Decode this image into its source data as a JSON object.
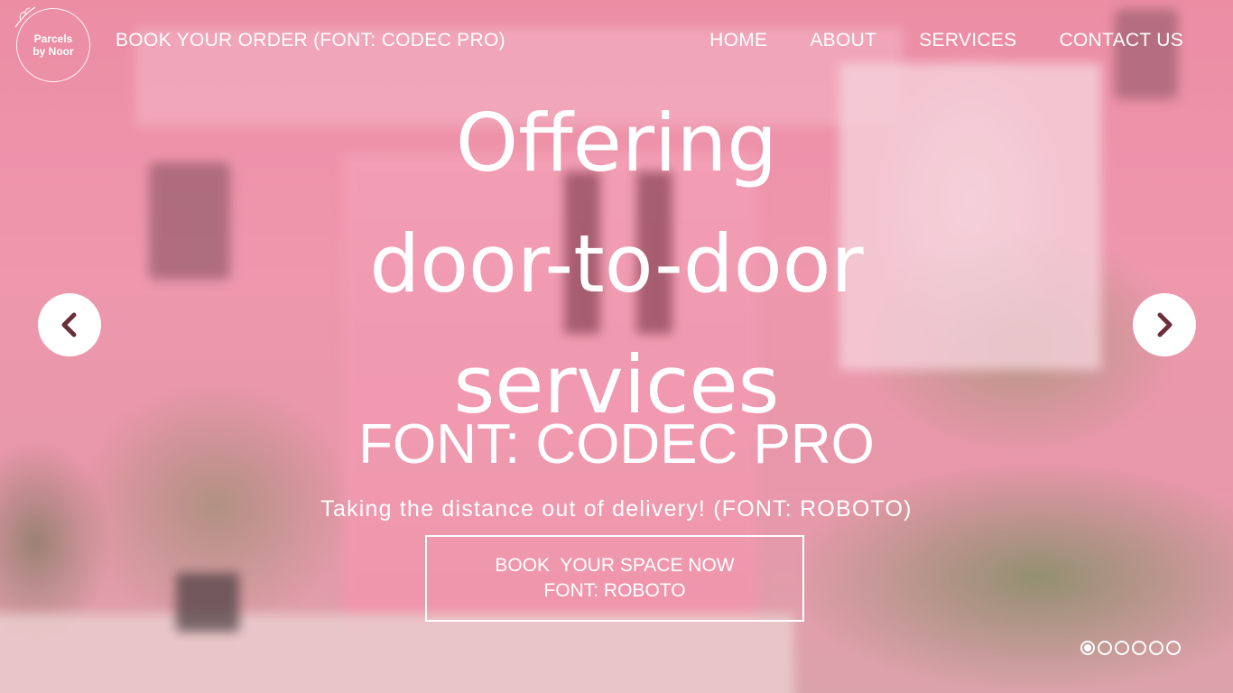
{
  "logo": {
    "line1": "Parcels",
    "line2": "by Noor"
  },
  "nav": {
    "book_order": "BOOK YOUR ORDER (FONT: CODEC PRO)",
    "items": [
      {
        "label": "HOME"
      },
      {
        "label": "ABOUT"
      },
      {
        "label": "SERVICES"
      },
      {
        "label": "CONTACT US"
      }
    ]
  },
  "hero": {
    "headline_lines": [
      "Offering",
      "door-to-door",
      "services"
    ],
    "subheading": "FONT: CODEC PRO",
    "tagline": "Taking the distance out of delivery! (FONT: ROBOTO)",
    "cta_line1": "BOOK  YOUR SPACE NOW",
    "cta_line2": "FONT: ROBOTO"
  },
  "carousel": {
    "prev_icon": "chevron-left-icon",
    "next_icon": "chevron-right-icon",
    "slide_count": 6,
    "active_index": 0
  },
  "colors": {
    "text": "#ffffff",
    "arrow_chevron": "#6b2f3a",
    "background_pink": "#ee9ab0"
  }
}
